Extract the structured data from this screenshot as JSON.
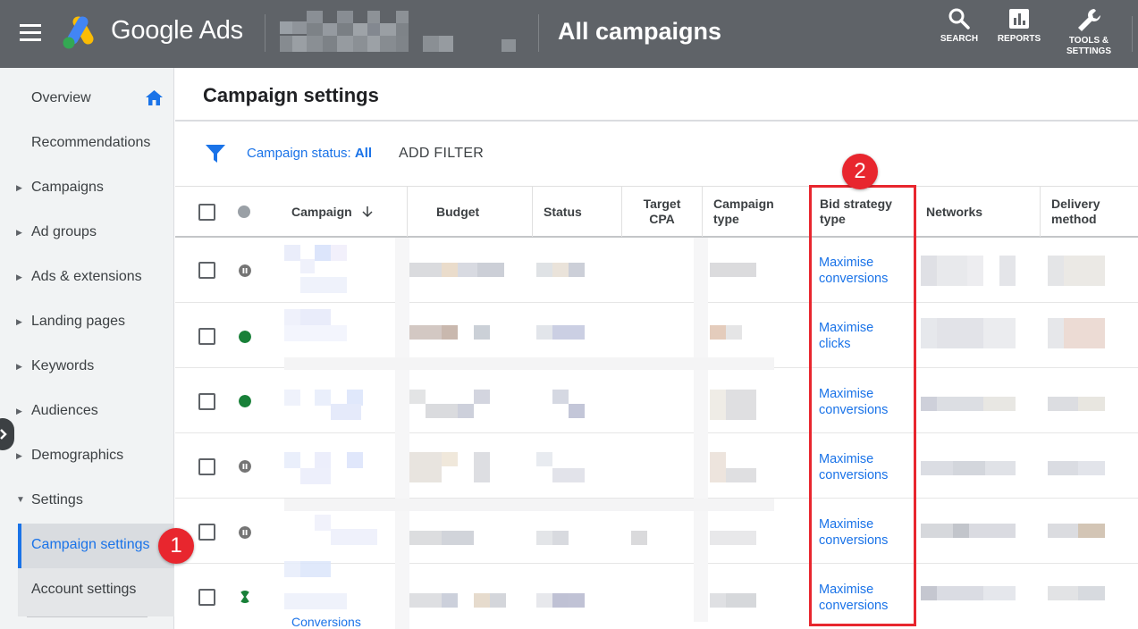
{
  "topbar": {
    "brand": "Google Ads",
    "page_heading": "All campaigns",
    "search_label": "SEARCH",
    "reports_label": "REPORTS",
    "tools_label_line1": "TOOLS &",
    "tools_label_line2": "SETTINGS",
    "bg_color": "#5f6368"
  },
  "sidebar": {
    "items": [
      {
        "label": "Overview"
      },
      {
        "label": "Recommendations"
      },
      {
        "label": "Campaigns"
      },
      {
        "label": "Ad groups"
      },
      {
        "label": "Ads & extensions"
      },
      {
        "label": "Landing pages"
      },
      {
        "label": "Keywords"
      },
      {
        "label": "Audiences"
      },
      {
        "label": "Demographics"
      },
      {
        "label": "Settings"
      },
      {
        "label": "Campaign settings"
      },
      {
        "label": "Account settings"
      }
    ],
    "accent_color": "#1a73e8"
  },
  "main": {
    "title": "Campaign settings",
    "filter": {
      "status_label": "Campaign status:",
      "status_value": "All",
      "add_filter": "ADD FILTER"
    },
    "table": {
      "columns": [
        {
          "label": "Campaign"
        },
        {
          "label": "Budget"
        },
        {
          "label": "Status"
        },
        {
          "label": "Target CPA"
        },
        {
          "label": "Campaign type"
        },
        {
          "label": "Bid strategy type"
        },
        {
          "label": "Networks"
        },
        {
          "label": "Delivery method"
        }
      ],
      "rows": [
        {
          "status": "paused",
          "bid_line1": "Maximise",
          "bid_line2": "conversions"
        },
        {
          "status": "enabled",
          "bid_line1": "Maximise",
          "bid_line2": "clicks"
        },
        {
          "status": "enabled",
          "bid_line1": "Maximise",
          "bid_line2": "conversions"
        },
        {
          "status": "paused",
          "bid_line1": "Maximise",
          "bid_line2": "conversions"
        },
        {
          "status": "paused",
          "bid_line1": "Maximise",
          "bid_line2": "conversions"
        },
        {
          "status": "pending",
          "bid_line1": "Maximise",
          "bid_line2": "conversions"
        }
      ],
      "bottom_fragment": "Conversions"
    }
  },
  "annotations": {
    "badge1": "1",
    "badge2": "2",
    "color": "#e8262e"
  }
}
